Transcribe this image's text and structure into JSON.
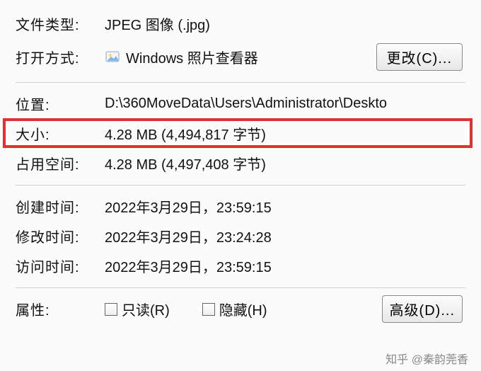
{
  "labels": {
    "file_type": "文件类型:",
    "open_with": "打开方式:",
    "location": "位置:",
    "size": "大小:",
    "size_on_disk": "占用空间:",
    "created": "创建时间:",
    "modified": "修改时间:",
    "accessed": "访问时间:",
    "attributes": "属性:"
  },
  "values": {
    "file_type": "JPEG 图像 (.jpg)",
    "open_with": "Windows 照片查看器",
    "location": "D:\\360MoveData\\Users\\Administrator\\Deskto",
    "size": "4.28 MB (4,494,817 字节)",
    "size_on_disk": "4.28 MB (4,497,408 字节)",
    "created": "2022年3月29日，23:59:15",
    "modified": "2022年3月29日，23:24:28",
    "accessed": "2022年3月29日，23:59:15"
  },
  "buttons": {
    "change": "更改(C)...",
    "advanced": "高级(D)..."
  },
  "attributes": {
    "readonly": "只读(R)",
    "hidden": "隐藏(H)"
  },
  "icons": {
    "photo_viewer": "photo-viewer-icon"
  },
  "watermark": "知乎 @秦韵莞香"
}
